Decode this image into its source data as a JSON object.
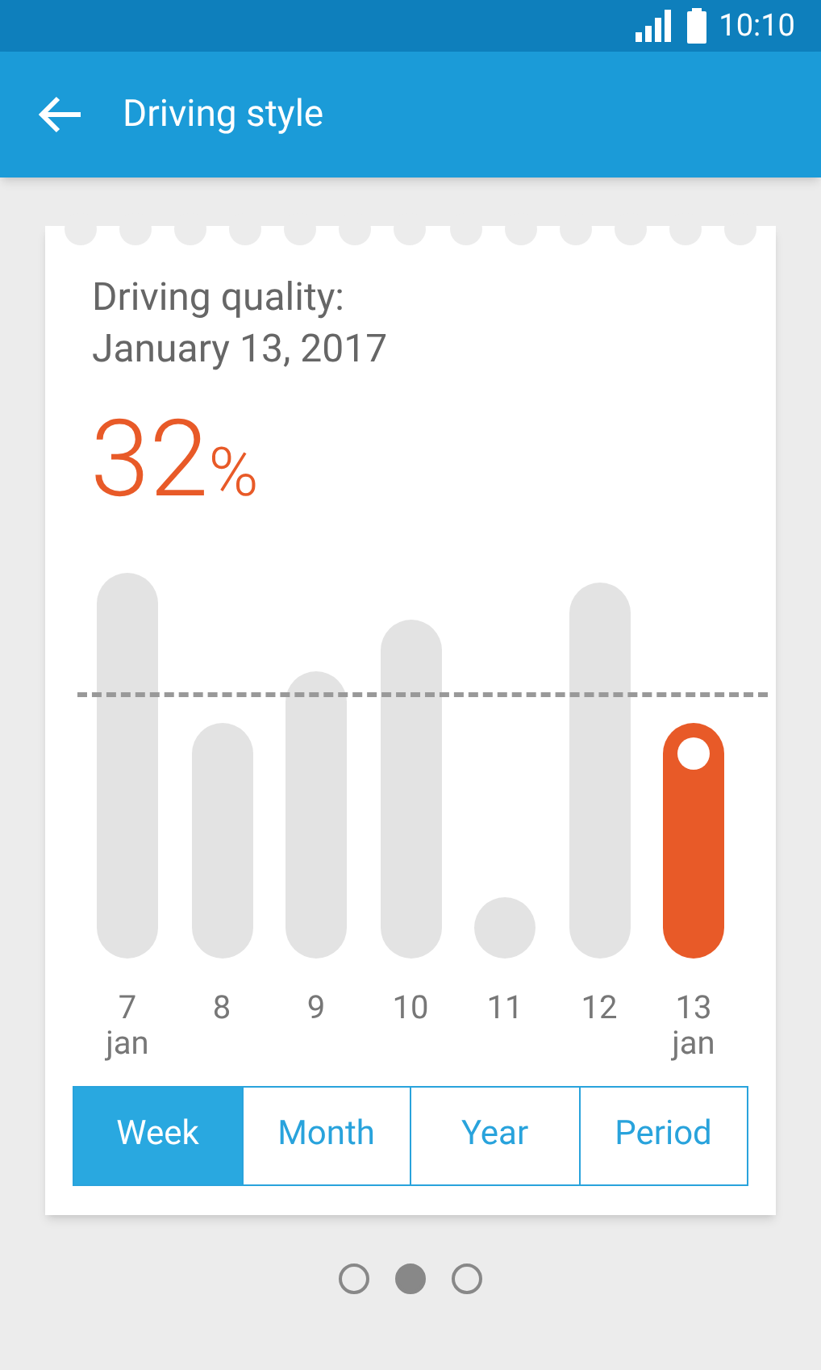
{
  "status_bar": {
    "time": "10:10"
  },
  "app_bar": {
    "title": "Driving style"
  },
  "card": {
    "title_line_1": "Driving quality:",
    "title_line_2": "January 13, 2017",
    "score": "32",
    "unit": "%",
    "days": [
      {
        "day": "7",
        "month": "jan",
        "selected": false
      },
      {
        "day": "8",
        "selected": false
      },
      {
        "day": "9",
        "selected": false
      },
      {
        "day": "10",
        "selected": false
      },
      {
        "day": "11",
        "selected": false
      },
      {
        "day": "12",
        "selected": false
      },
      {
        "day": "13",
        "month": "jan",
        "selected": true
      }
    ],
    "tabs": [
      {
        "label": "Week",
        "selected": true
      },
      {
        "label": "Month",
        "selected": false
      },
      {
        "label": "Year",
        "selected": false
      },
      {
        "label": "Period",
        "selected": false
      }
    ]
  },
  "pager": [
    {
      "selected": false
    },
    {
      "selected": true
    },
    {
      "selected": false
    }
  ]
}
